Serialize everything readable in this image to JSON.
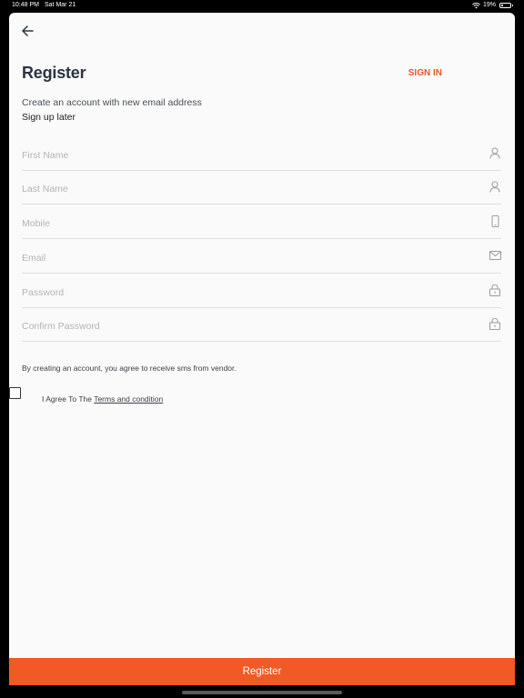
{
  "status_bar": {
    "time": "10:48 PM",
    "date": "Sat Mar 21",
    "battery": "19%",
    "battery_level": 0.19
  },
  "header": {
    "title": "Register",
    "sign_in": "SIGN IN"
  },
  "subtitle": "Create an account with new email address",
  "sign_up_later": "Sign up later",
  "fields": [
    {
      "placeholder": "First Name",
      "value": "",
      "icon": "person-icon"
    },
    {
      "placeholder": "Last Name",
      "value": "",
      "icon": "person-icon"
    },
    {
      "placeholder": "Mobile",
      "value": "",
      "icon": "phone-icon"
    },
    {
      "placeholder": "Email",
      "value": "",
      "icon": "mail-icon"
    },
    {
      "placeholder": "Password",
      "value": "",
      "icon": "lock-icon"
    },
    {
      "placeholder": "Confirm Password",
      "value": "",
      "icon": "lock-icon"
    }
  ],
  "notice": "By creating an account, you agree to receive sms from vendor.",
  "agree": {
    "prefix": "I Agree To The ",
    "link": "Terms and condition",
    "checked": false
  },
  "register_button": "Register",
  "colors": {
    "accent": "#f15a24",
    "sign_in": "#e8572a",
    "title": "#2b3440"
  }
}
